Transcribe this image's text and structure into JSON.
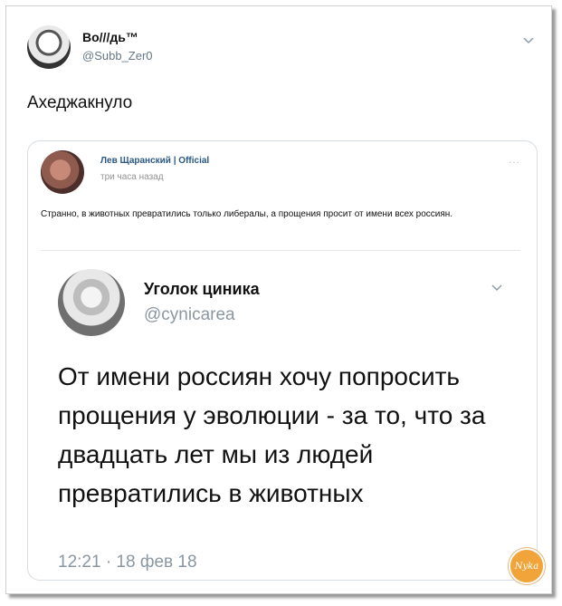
{
  "post": {
    "author_name": "Во///дь™",
    "author_handle": "@Subb_Zer0",
    "text": "Ахеджакнуло"
  },
  "quoted": {
    "author": "Лев Щаранский | Official",
    "time": "три часа назад",
    "menu": "···",
    "text": "Странно, в животных превратились только либералы, а прощения просит от имени всех россиян.",
    "embedded_tweet": {
      "author_name": "Уголок циника",
      "author_handle": "@cynicarea",
      "text": "От имени россиян хочу попросить прощения у эволюции - за то, что за двадцать лет мы из людей превратились в животных",
      "date": "12:21 · 18 фев 18"
    }
  },
  "watermark": "Nyka",
  "icons": {
    "post_menu": "chevron-down-icon",
    "embedded_menu": "chevron-down-icon"
  }
}
